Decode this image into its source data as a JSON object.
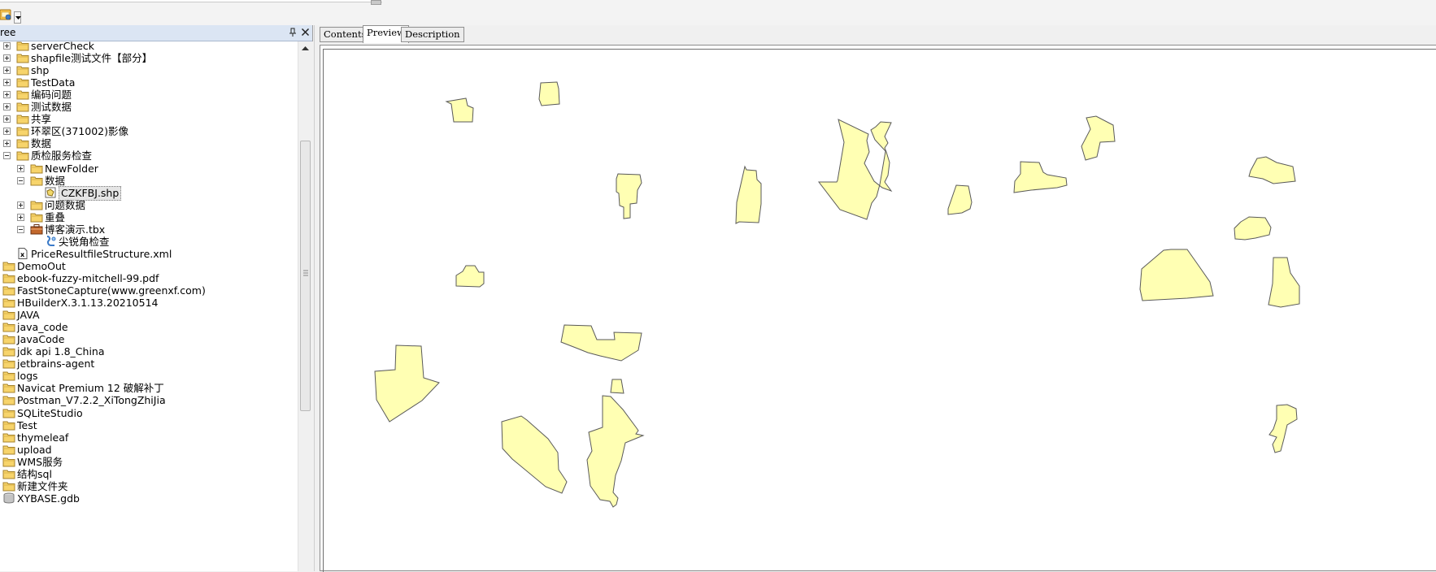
{
  "tree": {
    "title": "ree",
    "items": [
      {
        "label": "serverCheck",
        "indent": 0,
        "toggle": "plus",
        "icon": "folder"
      },
      {
        "label": "shapfile测试文件【部分】",
        "indent": 0,
        "toggle": "plus",
        "icon": "folder"
      },
      {
        "label": "shp",
        "indent": 0,
        "toggle": "plus",
        "icon": "folder"
      },
      {
        "label": "TestData",
        "indent": 0,
        "toggle": "plus",
        "icon": "folder"
      },
      {
        "label": "编码问题",
        "indent": 0,
        "toggle": "plus",
        "icon": "folder"
      },
      {
        "label": "测试数据",
        "indent": 0,
        "toggle": "plus",
        "icon": "folder"
      },
      {
        "label": "共享",
        "indent": 0,
        "toggle": "plus",
        "icon": "folder"
      },
      {
        "label": "环翠区(371002)影像",
        "indent": 0,
        "toggle": "plus",
        "icon": "folder"
      },
      {
        "label": "数据",
        "indent": 0,
        "toggle": "plus",
        "icon": "folder"
      },
      {
        "label": "质检服务检查",
        "indent": 0,
        "toggle": "minus",
        "icon": "folder"
      },
      {
        "label": "NewFolder",
        "indent": 1,
        "toggle": "plus",
        "icon": "folder"
      },
      {
        "label": "数据",
        "indent": 1,
        "toggle": "minus",
        "icon": "folder"
      },
      {
        "label": "CZKFBJ.shp",
        "indent": 2,
        "toggle": "none",
        "icon": "shapefile",
        "selected": true
      },
      {
        "label": "问题数据",
        "indent": 1,
        "toggle": "plus",
        "icon": "folder"
      },
      {
        "label": "重叠",
        "indent": 1,
        "toggle": "plus",
        "icon": "folder"
      },
      {
        "label": "博客演示.tbx",
        "indent": 1,
        "toggle": "minus",
        "icon": "toolbox"
      },
      {
        "label": "尖锐角检查",
        "indent": 2,
        "toggle": "none",
        "icon": "script"
      },
      {
        "label": "PriceResultfileStructure.xml",
        "indent": 0,
        "toggle": "none",
        "icon": "xml"
      },
      {
        "label": "DemoOut",
        "indent": -1,
        "toggle": "none",
        "icon": "folder"
      },
      {
        "label": "ebook-fuzzy-mitchell-99.pdf",
        "indent": -1,
        "toggle": "none",
        "icon": "folder"
      },
      {
        "label": "FastStoneCapture(www.greenxf.com)",
        "indent": -1,
        "toggle": "none",
        "icon": "folder"
      },
      {
        "label": "HBuilderX.3.1.13.20210514",
        "indent": -1,
        "toggle": "none",
        "icon": "folder"
      },
      {
        "label": "JAVA",
        "indent": -1,
        "toggle": "none",
        "icon": "folder"
      },
      {
        "label": "java_code",
        "indent": -1,
        "toggle": "none",
        "icon": "folder"
      },
      {
        "label": "JavaCode",
        "indent": -1,
        "toggle": "none",
        "icon": "folder"
      },
      {
        "label": "jdk api 1.8_China",
        "indent": -1,
        "toggle": "none",
        "icon": "folder"
      },
      {
        "label": "jetbrains-agent",
        "indent": -1,
        "toggle": "none",
        "icon": "folder"
      },
      {
        "label": "logs",
        "indent": -1,
        "toggle": "none",
        "icon": "folder"
      },
      {
        "label": "Navicat Premium 12 破解补丁",
        "indent": -1,
        "toggle": "none",
        "icon": "folder"
      },
      {
        "label": "Postman_V7.2.2_XiTongZhiJia",
        "indent": -1,
        "toggle": "none",
        "icon": "folder"
      },
      {
        "label": "SQLiteStudio",
        "indent": -1,
        "toggle": "none",
        "icon": "folder"
      },
      {
        "label": "Test",
        "indent": -1,
        "toggle": "none",
        "icon": "folder"
      },
      {
        "label": "thymeleaf",
        "indent": -1,
        "toggle": "none",
        "icon": "folder"
      },
      {
        "label": "upload",
        "indent": -1,
        "toggle": "none",
        "icon": "folder"
      },
      {
        "label": "WMS服务",
        "indent": -1,
        "toggle": "none",
        "icon": "folder"
      },
      {
        "label": "结构sql",
        "indent": -1,
        "toggle": "none",
        "icon": "folder"
      },
      {
        "label": "新建文件夹",
        "indent": -1,
        "toggle": "none",
        "icon": "folder"
      },
      {
        "label": "XYBASE.gdb",
        "indent": -1,
        "toggle": "none",
        "icon": "database"
      }
    ]
  },
  "tabs": [
    {
      "label": "Contents",
      "active": false
    },
    {
      "label": "Preview",
      "active": true
    },
    {
      "label": "Description",
      "active": false
    }
  ],
  "icons": {
    "toolbar": "catalog-icon",
    "pin": "pin-icon",
    "close": "close-icon"
  },
  "colors": {
    "polygon_fill": "#ffffb3",
    "polygon_stroke": "#5a5a5a",
    "panel_header": "#dbe5f3"
  }
}
